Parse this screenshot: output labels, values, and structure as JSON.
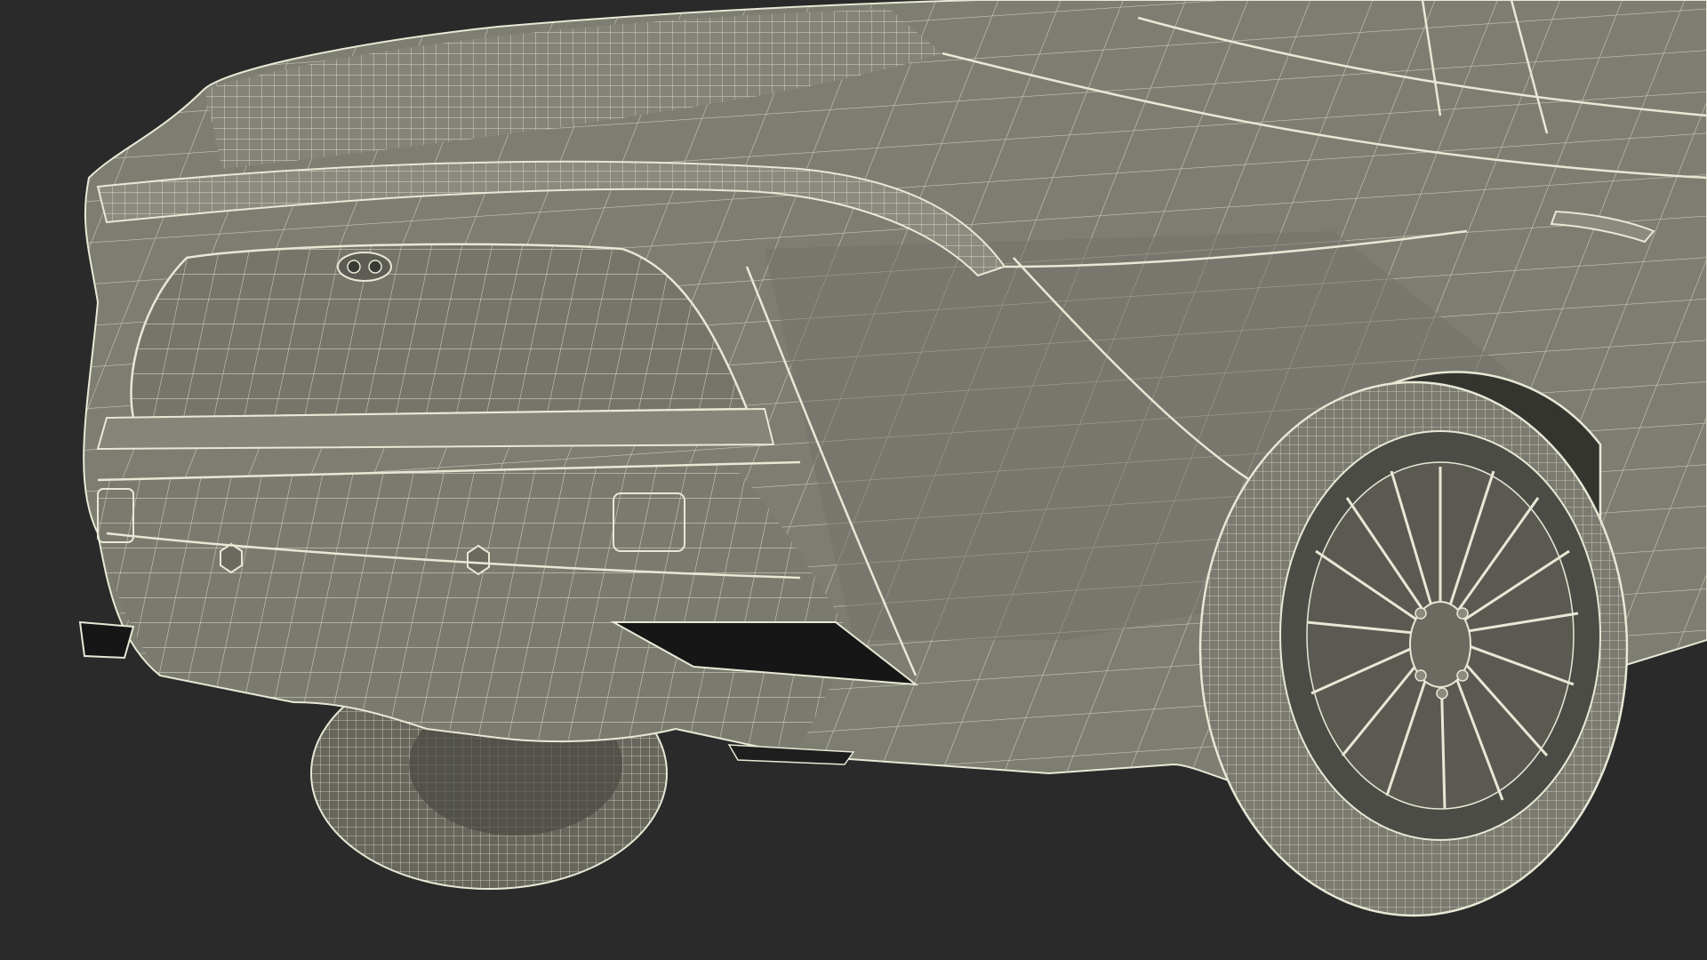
{
  "scene": {
    "subject": "wireframe-car-rear-three-quarter",
    "background_color": "#2a2a2a",
    "body_fill_color": "#7d7d72",
    "body_shadow_color": "#6b6b61",
    "wire_color": "#e8e8d6",
    "dark_opening_color": "#161616"
  }
}
